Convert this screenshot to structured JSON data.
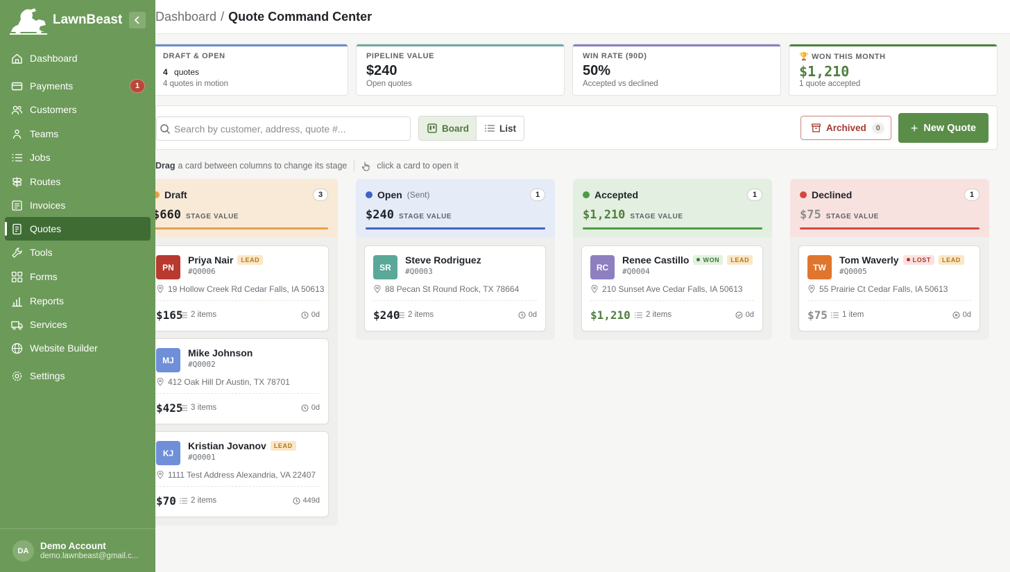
{
  "app": {
    "brand": "LawnBeast"
  },
  "breadcrumb": {
    "previous": "Dashboard",
    "separator": "/",
    "current": "Quote Command Center"
  },
  "sidebar": {
    "items": [
      {
        "label": "Dashboard",
        "icon": "home-icon"
      },
      {
        "label": "Payments",
        "icon": "card-icon",
        "badge": "1"
      },
      {
        "label": "Customers",
        "icon": "users-icon"
      },
      {
        "label": "Teams",
        "icon": "team-icon"
      },
      {
        "label": "Jobs",
        "icon": "list-icon"
      },
      {
        "label": "Routes",
        "icon": "signpost-icon"
      },
      {
        "label": "Invoices",
        "icon": "invoice-icon"
      },
      {
        "label": "Quotes",
        "icon": "quote-icon",
        "active": true
      },
      {
        "label": "Tools",
        "icon": "wrench-icon"
      },
      {
        "label": "Forms",
        "icon": "grid-icon"
      },
      {
        "label": "Reports",
        "icon": "chart-icon"
      },
      {
        "label": "Services",
        "icon": "truck-icon"
      },
      {
        "label": "Website Builder",
        "icon": "globe-icon"
      },
      {
        "label": "Settings",
        "icon": "gear-icon"
      }
    ],
    "account": {
      "initials": "DA",
      "name": "Demo Account",
      "email": "demo.lawnbeast@gmail.c..."
    }
  },
  "stats": [
    {
      "label": "DRAFT & OPEN",
      "value": "4",
      "value_suffix": "quotes",
      "sub": "4 quotes in motion",
      "accent": "#6d8bc9"
    },
    {
      "label": "PIPELINE VALUE",
      "value": "$240",
      "sub": "Open quotes",
      "accent": "#6fa9a1"
    },
    {
      "label": "WIN RATE (90D)",
      "value": "50%",
      "sub": "Accepted vs declined",
      "accent": "#8b7fc0"
    },
    {
      "label": "WON THIS MONTH",
      "value": "$1,210",
      "sub": "1 quote accepted",
      "accent": "#4f7f3f"
    }
  ],
  "toolbar": {
    "search_placeholder": "Search by customer, address, quote #...",
    "board_label": "Board",
    "list_label": "List",
    "archived_label": "Archived",
    "archived_count": "0",
    "new_quote_label": "New Quote"
  },
  "hint": {
    "drag": "Drag",
    "drag_text": "a card between columns to change its stage",
    "click_text": "click a card to open it"
  },
  "columns": [
    {
      "title": "Draft",
      "subtitle": "",
      "count": "3",
      "value": "$660",
      "value_label": "STAGE VALUE",
      "color": "#e2a24a",
      "bg": "#f8ead6",
      "cards": [
        {
          "initials": "PN",
          "name": "Priya Nair",
          "quote": "#Q0006",
          "address": "19 Hollow Creek Rd Cedar Falls, IA 50613",
          "price": "$165",
          "items": "2 items",
          "age": "0d",
          "tags": [
            "LEAD"
          ],
          "avatar": "#b8392f"
        },
        {
          "initials": "MJ",
          "name": "Mike Johnson",
          "quote": "#Q0002",
          "address": "412 Oak Hill Dr Austin, TX 78701",
          "price": "$425",
          "items": "3 items",
          "age": "0d",
          "tags": [],
          "avatar": "#6f8fd8"
        },
        {
          "initials": "KJ",
          "name": "Kristian Jovanov",
          "quote": "#Q0001",
          "address": "1111 Test Address Alexandria, VA 22407",
          "price": "$70",
          "items": "2 items",
          "age": "449d",
          "tags": [
            "LEAD"
          ],
          "avatar": "#6f8fd8"
        }
      ]
    },
    {
      "title": "Open",
      "subtitle": "(Sent)",
      "count": "1",
      "value": "$240",
      "value_label": "STAGE VALUE",
      "color": "#3f63c8",
      "bg": "#e5ebf7",
      "cards": [
        {
          "initials": "SR",
          "name": "Steve Rodriguez",
          "quote": "#Q0003",
          "address": "88 Pecan St Round Rock, TX 78664",
          "price": "$240",
          "items": "2 items",
          "age": "0d",
          "tags": [],
          "avatar": "#5aa898"
        }
      ]
    },
    {
      "title": "Accepted",
      "subtitle": "",
      "count": "1",
      "value": "$1,210",
      "value_label": "STAGE VALUE",
      "color": "#4e9a45",
      "bg": "#e3efe0",
      "cards": [
        {
          "initials": "RC",
          "name": "Renee Castillo",
          "quote": "#Q0004",
          "address": "210 Sunset Ave Cedar Falls, IA 50613",
          "price": "$1,210",
          "items": "2 items",
          "age": "0d",
          "tags": [
            "WON",
            "LEAD"
          ],
          "avatar": "#8d7fc0"
        }
      ]
    },
    {
      "title": "Declined",
      "subtitle": "",
      "count": "1",
      "value": "$75",
      "value_label": "STAGE VALUE",
      "color": "#d2473f",
      "bg": "#f8e2e0",
      "cards": [
        {
          "initials": "TW",
          "name": "Tom Waverly",
          "quote": "#Q0005",
          "address": "55 Prairie Ct Cedar Falls, IA 50613",
          "price": "$75",
          "items": "1 item",
          "age": "0d",
          "tags": [
            "LOST",
            "LEAD"
          ],
          "avatar": "#e0762e"
        }
      ]
    }
  ]
}
